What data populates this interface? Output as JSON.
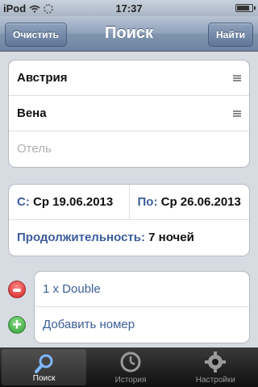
{
  "statusbar": {
    "carrier": "iPod",
    "time": "17:37",
    "battery_level": 0.85
  },
  "navbar": {
    "title": "Поиск",
    "left_button": "Очистить",
    "right_button": "Найти"
  },
  "destination": {
    "country": "Австрия",
    "city": "Вена",
    "hotel_placeholder": "Отель"
  },
  "dates": {
    "from_label": "С:",
    "from_value": "Ср 19.06.2013",
    "to_label": "По:",
    "to_value": "Ср 26.06.2013",
    "duration_label": "Продолжительность:",
    "duration_value": "7 ночей"
  },
  "rooms": {
    "items": [
      "1 x Double"
    ],
    "add_label": "Добавить номер"
  },
  "tabbar": {
    "tabs": [
      {
        "label": "Поиск",
        "icon": "search-icon",
        "active": true
      },
      {
        "label": "История",
        "icon": "clock-icon",
        "active": false
      },
      {
        "label": "Настройки",
        "icon": "gear-icon",
        "active": false
      }
    ]
  },
  "colors": {
    "accent_blue": "#3b5d9b",
    "remove_red": "#d11f1f",
    "add_green": "#2d9a2d"
  }
}
